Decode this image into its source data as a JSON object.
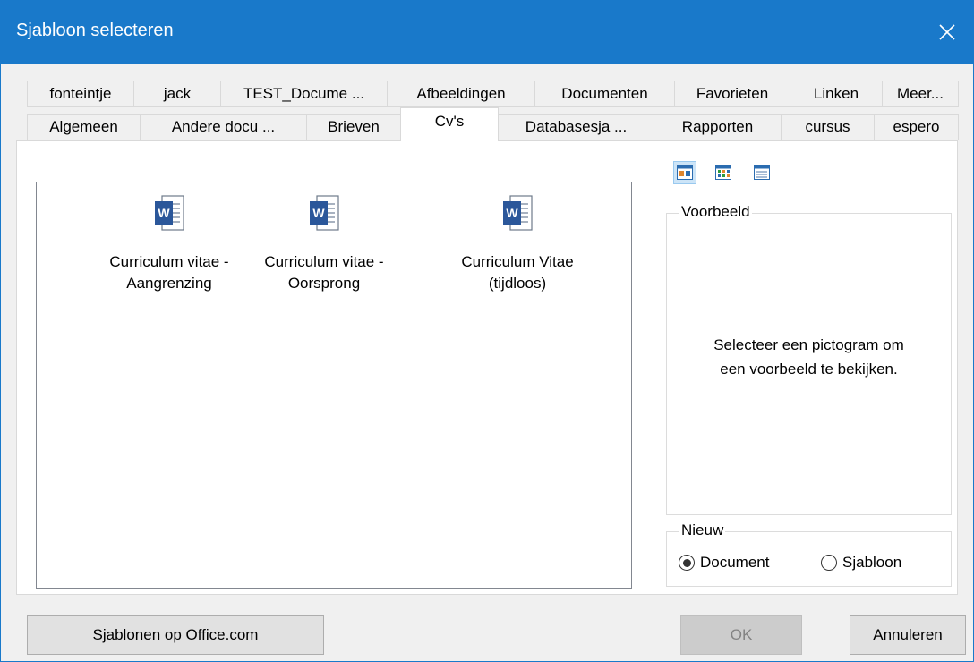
{
  "window": {
    "title": "Sjabloon selecteren"
  },
  "tabs_row1": [
    {
      "label": "fonteintje"
    },
    {
      "label": "jack"
    },
    {
      "label": "TEST_Docume ..."
    },
    {
      "label": "Afbeeldingen"
    },
    {
      "label": "Documenten"
    },
    {
      "label": "Favorieten"
    },
    {
      "label": "Linken"
    },
    {
      "label": "Meer..."
    }
  ],
  "tabs_row2": [
    {
      "label": "Algemeen"
    },
    {
      "label": "Andere docu ..."
    },
    {
      "label": "Brieven"
    },
    {
      "label": "Cv's",
      "active": true
    },
    {
      "label": "Databasesja ..."
    },
    {
      "label": "Rapporten"
    },
    {
      "label": "cursus"
    },
    {
      "label": "espero"
    }
  ],
  "templates": [
    {
      "line1": "Curriculum vitae -",
      "line2": "Aangrenzing",
      "icon": "word-document-icon"
    },
    {
      "line1": "Curriculum vitae -",
      "line2": "Oorsprong",
      "icon": "word-document-icon"
    },
    {
      "line1": "Curriculum Vitae",
      "line2": "(tijdloos)",
      "icon": "word-document-icon"
    }
  ],
  "view_buttons": [
    "large-icons-view-icon",
    "list-view-icon",
    "details-view-icon"
  ],
  "preview": {
    "label": "Voorbeeld",
    "message_line1": "Selecteer een pictogram om",
    "message_line2": "een voorbeeld te bekijken."
  },
  "new_group": {
    "label": "Nieuw",
    "options": [
      {
        "label": "Document",
        "selected": true
      },
      {
        "label": "Sjabloon",
        "selected": false
      }
    ]
  },
  "buttons": {
    "office_label": "Sjablonen op Office.com",
    "ok_label": "OK",
    "cancel_label": "Annuleren"
  },
  "colors": {
    "titlebar": "#1979ca",
    "word_blue": "#2b579a"
  }
}
